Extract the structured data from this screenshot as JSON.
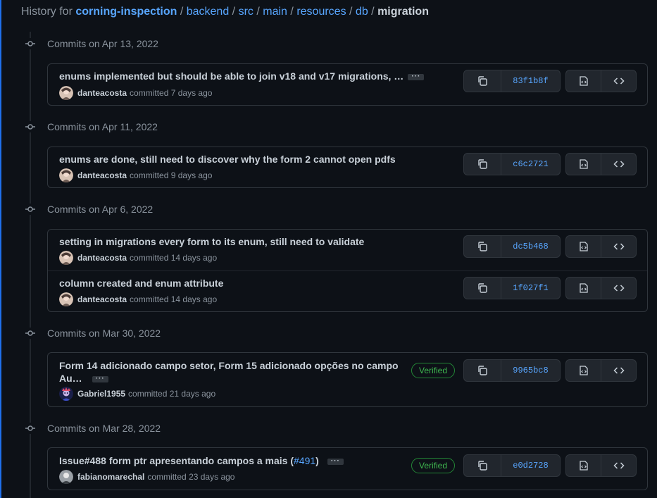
{
  "breadcrumb": {
    "prefix": "History for",
    "repo": "corning-inspection",
    "segments": [
      "backend",
      "src",
      "main",
      "resources",
      "db"
    ],
    "current": "migration"
  },
  "groups": [
    {
      "date_label": "Commits on Apr 13, 2022",
      "commits": [
        {
          "message": "enums implemented but should be able to join v18 and v17 migrations, …",
          "ellipsis": "···",
          "author": "danteacosta",
          "action": "committed",
          "time": "7 days ago",
          "sha": "83f1b8f",
          "verified": null
        }
      ]
    },
    {
      "date_label": "Commits on Apr 11, 2022",
      "commits": [
        {
          "message": "enums are done, still need to discover why the form 2 cannot open pdfs",
          "author": "danteacosta",
          "action": "committed",
          "time": "9 days ago",
          "sha": "c6c2721",
          "verified": null
        }
      ]
    },
    {
      "date_label": "Commits on Apr 6, 2022",
      "commits": [
        {
          "message": "setting in migrations every form to its enum, still need to validate",
          "author": "danteacosta",
          "action": "committed",
          "time": "14 days ago",
          "sha": "dc5b468",
          "verified": null
        },
        {
          "message": "column created and enum attribute",
          "author": "danteacosta",
          "action": "committed",
          "time": "14 days ago",
          "sha": "1f027f1",
          "verified": null
        }
      ]
    },
    {
      "date_label": "Commits on Mar 30, 2022",
      "commits": [
        {
          "message_line1": "Form 14 adicionado campo setor, Form 15 adicionado opções no campo",
          "message_line2": "Au…",
          "ellipsis": "···",
          "author": "Gabriel1955",
          "action": "committed",
          "time": "21 days ago",
          "sha": "9965bc8",
          "verified": "Verified"
        }
      ]
    },
    {
      "date_label": "Commits on Mar 28, 2022",
      "commits": [
        {
          "message_prefix": "Issue#488 form ptr apresentando campos a mais (",
          "message_link": "#491",
          "message_suffix": ")",
          "ellipsis": "···",
          "author": "fabianomarechal",
          "action": "committed",
          "time": "23 days ago",
          "sha": "e0d2728",
          "verified": "Verified"
        }
      ]
    }
  ],
  "colors": {
    "accent": "#58a6ff",
    "verified": "#3fb950",
    "bg": "#0d1117",
    "border": "#30363d"
  }
}
